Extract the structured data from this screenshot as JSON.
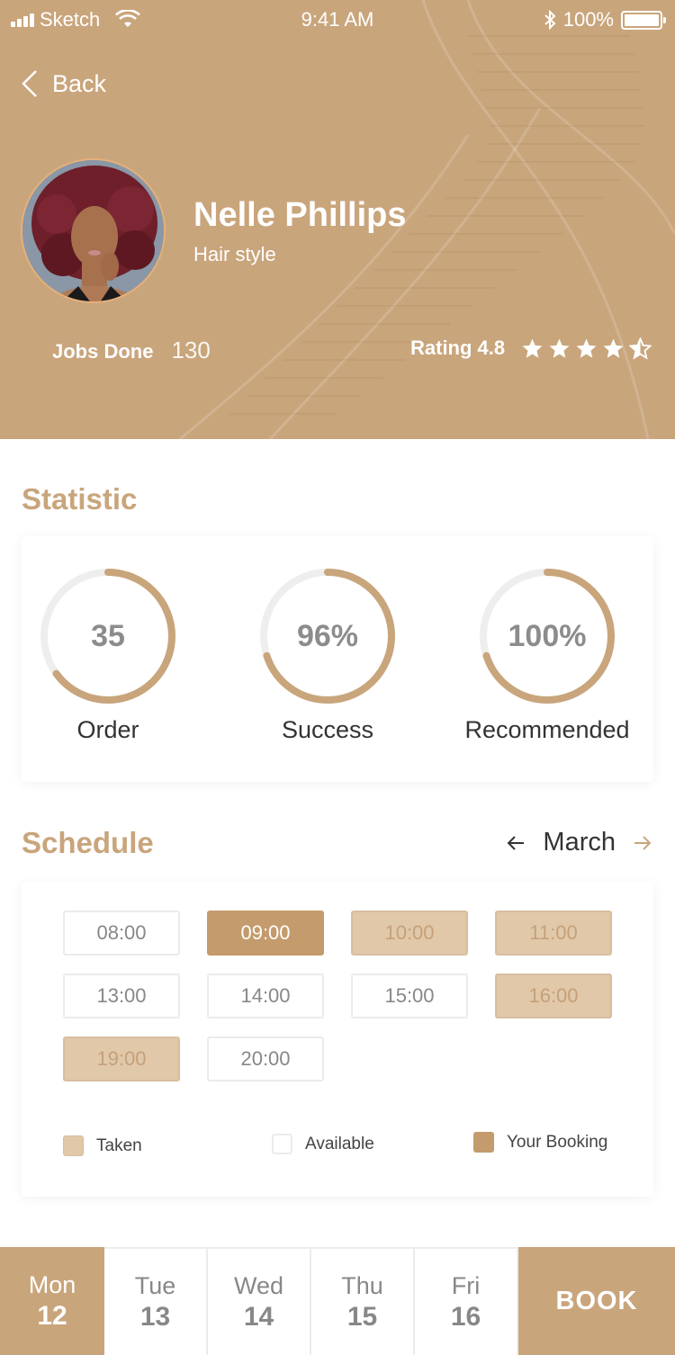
{
  "status_bar": {
    "carrier": "Sketch",
    "time": "9:41 AM",
    "battery": "100%"
  },
  "nav": {
    "back_label": "Back"
  },
  "profile": {
    "name": "Nelle Phillips",
    "role": "Hair style"
  },
  "stats_row": {
    "jobs_label": "Jobs Done",
    "jobs_value": "130",
    "rating_label": "Rating 4.8",
    "rating_value": 4.8,
    "stars_max": 5
  },
  "colors": {
    "accent": "#c9a57c",
    "taken": "#e1c8a9",
    "booking": "#c49b6c"
  },
  "statistic": {
    "title": "Statistic",
    "items": [
      {
        "value": "35",
        "label": "Order",
        "progress": 0.65
      },
      {
        "value": "96%",
        "label": "Success",
        "progress": 0.7
      },
      {
        "value": "100%",
        "label": "Recommended",
        "progress": 0.7
      }
    ]
  },
  "schedule": {
    "title": "Schedule",
    "month": "March",
    "slots": [
      {
        "time": "08:00",
        "state": "available"
      },
      {
        "time": "09:00",
        "state": "booked"
      },
      {
        "time": "10:00",
        "state": "taken"
      },
      {
        "time": "11:00",
        "state": "taken"
      },
      {
        "time": "13:00",
        "state": "available"
      },
      {
        "time": "14:00",
        "state": "available"
      },
      {
        "time": "15:00",
        "state": "available"
      },
      {
        "time": "16:00",
        "state": "taken"
      },
      {
        "time": "19:00",
        "state": "taken"
      },
      {
        "time": "20:00",
        "state": "available"
      }
    ],
    "legend": {
      "taken": "Taken",
      "available": "Available",
      "booking": "Your Booking"
    }
  },
  "days": [
    {
      "name": "Mon",
      "date": "12",
      "selected": true
    },
    {
      "name": "Tue",
      "date": "13",
      "selected": false
    },
    {
      "name": "Wed",
      "date": "14",
      "selected": false
    },
    {
      "name": "Thu",
      "date": "15",
      "selected": false
    },
    {
      "name": "Fri",
      "date": "16",
      "selected": false
    }
  ],
  "book_label": "BOOK"
}
